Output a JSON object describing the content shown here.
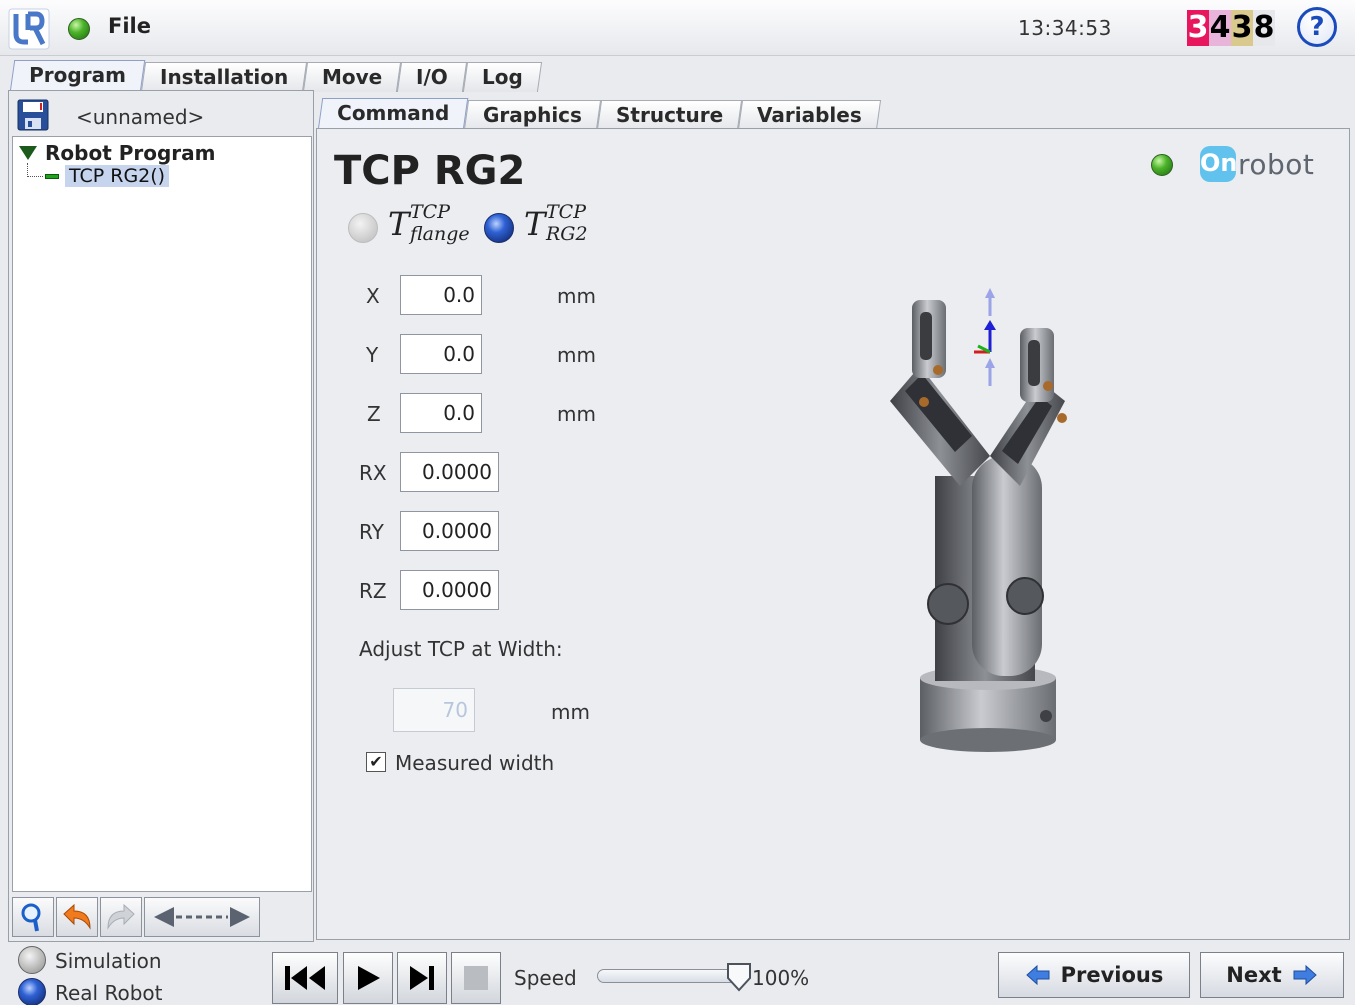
{
  "topbar": {
    "menu_label": "File",
    "clock": "13:34:53",
    "serial_digits": [
      {
        "char": "3",
        "color": "#e8175d",
        "text_color": "#ffffff"
      },
      {
        "char": "4",
        "color": "#e9b4da",
        "text_color": "#000000"
      },
      {
        "char": "3",
        "color": "#d9c98c",
        "text_color": "#000000"
      },
      {
        "char": "8",
        "color": "#e6e8ec",
        "text_color": "#000000"
      }
    ],
    "help_label": "?"
  },
  "main_tabs": [
    {
      "label": "Program",
      "active": true
    },
    {
      "label": "Installation",
      "active": false
    },
    {
      "label": "Move",
      "active": false
    },
    {
      "label": "I/O",
      "active": false
    },
    {
      "label": "Log",
      "active": false
    }
  ],
  "program": {
    "file_name": "<unnamed>",
    "tree_root": "Robot Program",
    "tree_child": "TCP RG2()"
  },
  "sub_tabs": [
    {
      "label": "Command",
      "active": true
    },
    {
      "label": "Graphics",
      "active": false
    },
    {
      "label": "Structure",
      "active": false
    },
    {
      "label": "Variables",
      "active": false
    }
  ],
  "panel": {
    "title": "TCP RG2",
    "brand": {
      "badge": "On",
      "text": "robot"
    },
    "tcp_options": [
      {
        "base": "T",
        "sup": "TCP",
        "sub": "flange",
        "selected": false
      },
      {
        "base": "T",
        "sup": "TCP",
        "sub": "RG2",
        "selected": true
      }
    ],
    "fields": [
      {
        "label": "X",
        "value": "0.0",
        "unit": "mm"
      },
      {
        "label": "Y",
        "value": "0.0",
        "unit": "mm"
      },
      {
        "label": "Z",
        "value": "0.0",
        "unit": "mm"
      },
      {
        "label": "RX",
        "value": "0.0000",
        "unit": ""
      },
      {
        "label": "RY",
        "value": "0.0000",
        "unit": ""
      },
      {
        "label": "RZ",
        "value": "0.0000",
        "unit": ""
      }
    ],
    "adjust_label": "Adjust TCP at Width:",
    "width_value": "70",
    "width_unit": "mm",
    "measured_label": "Measured width",
    "measured_checked": true
  },
  "bottombar": {
    "mode_simulation": "Simulation",
    "mode_real": "Real Robot",
    "speed_label": "Speed",
    "speed_value": "100%",
    "speed_fraction": 1.0,
    "previous_label": "Previous",
    "next_label": "Next"
  },
  "colors": {
    "accent_blue": "#2f62d5",
    "status_green": "#4cb32a",
    "onrobot_blue": "#62c2ee"
  }
}
